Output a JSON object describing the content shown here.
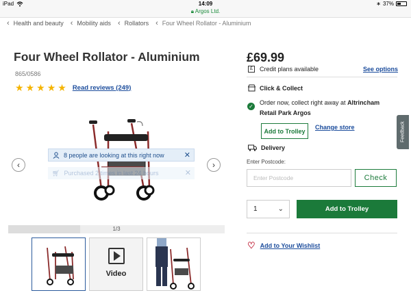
{
  "status_bar": {
    "device": "iPad",
    "time": "14:09",
    "site": "Argos Ltd.",
    "battery": "37%"
  },
  "breadcrumb": [
    {
      "label": "Health and beauty"
    },
    {
      "label": "Mobility aids"
    },
    {
      "label": "Rollators"
    },
    {
      "label": "Four Wheel Rollator - Aluminium"
    }
  ],
  "product": {
    "title": "Four Wheel Rollator - Aluminium",
    "sku": "865/0586",
    "rating": 5,
    "reviews_link": "Read reviews (249)"
  },
  "carousel": {
    "notice_primary": "8 people are looking at this right now",
    "notice_secondary": "Purchased 2 times in last 24 hours",
    "page_indicator": "1/3",
    "progress": 0.333,
    "video_label": "Video"
  },
  "buy_box": {
    "price": "£69.99",
    "credit_text": "Credit plans available",
    "see_options": "See options",
    "click_collect_title": "Click & Collect",
    "collect_prefix": "Order now, collect right away at ",
    "collect_store": "Altrincham Retail Park Argos",
    "add_to_trolley_small": "Add to Trolley",
    "change_store": "Change store",
    "delivery_title": "Delivery",
    "postcode_label": "Enter Postcode:",
    "postcode_placeholder": "Enter Postcode",
    "check_button": "Check",
    "quantity": "1",
    "add_to_trolley": "Add to Trolley",
    "wishlist": "Add to Your Wishlist"
  },
  "feedback_tab": "Feedback",
  "colors": {
    "green": "#1b7a3a",
    "link_blue": "#1b4c9c",
    "star": "#f5b400",
    "heart": "#c0243a"
  }
}
